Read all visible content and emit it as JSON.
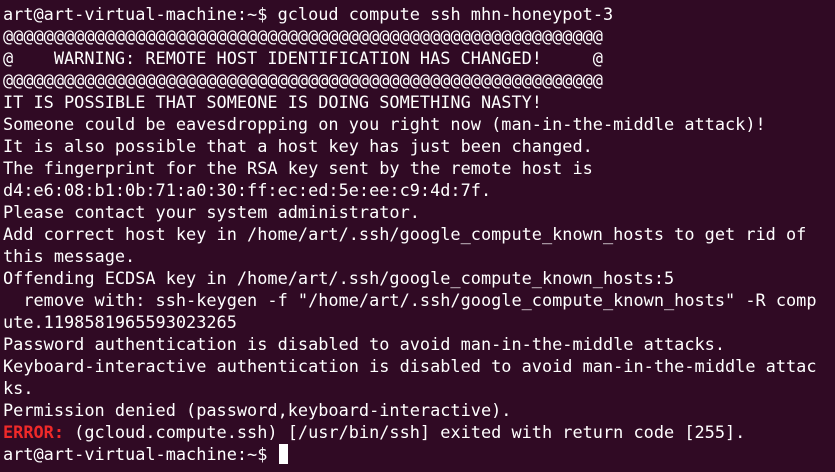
{
  "terminal": {
    "prompt": "art@art-virtual-machine:~$ ",
    "command": "gcloud compute ssh mhn-honeypot-3",
    "lines": [
      "@@@@@@@@@@@@@@@@@@@@@@@@@@@@@@@@@@@@@@@@@@@@@@@@@@@@@@@@@@@",
      "@    WARNING: REMOTE HOST IDENTIFICATION HAS CHANGED!     @",
      "@@@@@@@@@@@@@@@@@@@@@@@@@@@@@@@@@@@@@@@@@@@@@@@@@@@@@@@@@@@",
      "IT IS POSSIBLE THAT SOMEONE IS DOING SOMETHING NASTY!",
      "Someone could be eavesdropping on you right now (man-in-the-middle attack)!",
      "It is also possible that a host key has just been changed.",
      "The fingerprint for the RSA key sent by the remote host is",
      "d4:e6:08:b1:0b:71:a0:30:ff:ec:ed:5e:ee:c9:4d:7f.",
      "Please contact your system administrator.",
      "Add correct host key in /home/art/.ssh/google_compute_known_hosts to get rid of",
      "this message.",
      "Offending ECDSA key in /home/art/.ssh/google_compute_known_hosts:5",
      "  remove with: ssh-keygen -f \"/home/art/.ssh/google_compute_known_hosts\" -R comp",
      "ute.1198581965593023265",
      "Password authentication is disabled to avoid man-in-the-middle attacks.",
      "Keyboard-interactive authentication is disabled to avoid man-in-the-middle attac",
      "ks.",
      "Permission denied (password,keyboard-interactive)."
    ],
    "error_label": "ERROR:",
    "error_message": " (gcloud.compute.ssh) [/usr/bin/ssh] exited with return code [255].",
    "final_prompt": "art@art-virtual-machine:~$ "
  },
  "colors": {
    "background": "#300a24",
    "text": "#ffffff",
    "error": "#ef2929"
  }
}
